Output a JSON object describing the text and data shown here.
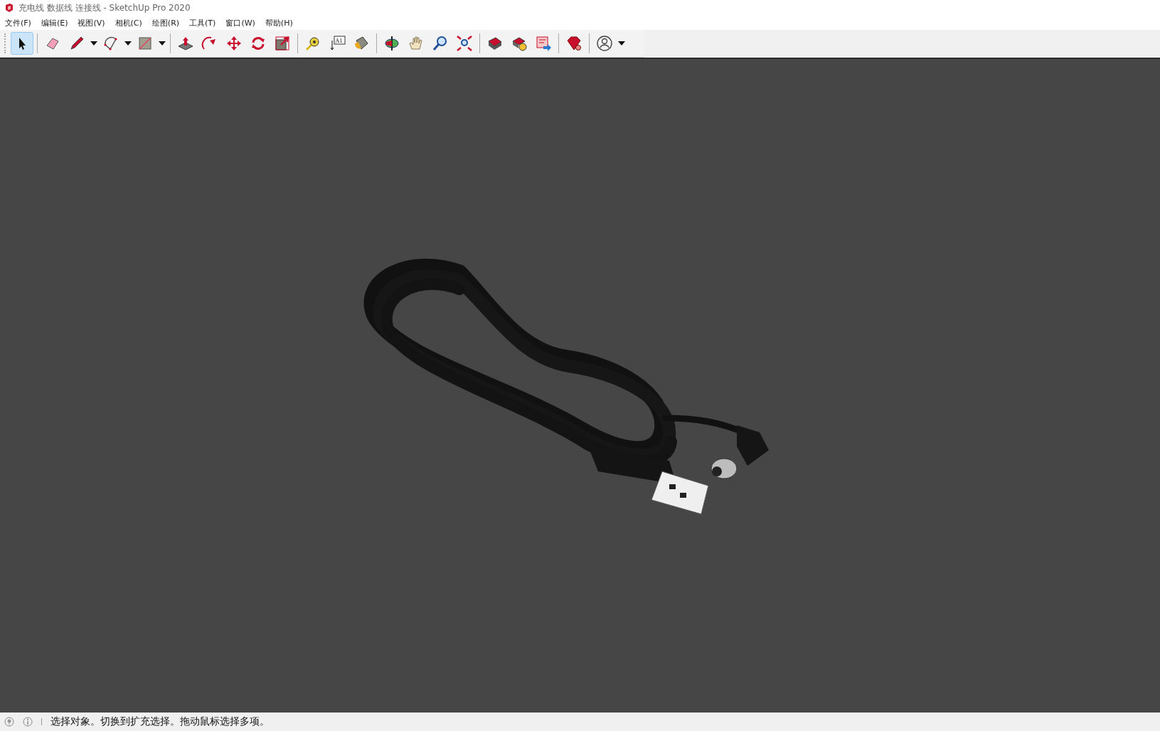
{
  "window": {
    "title": "充电线 数据线 连接线 - SketchUp Pro 2020"
  },
  "menu": [
    "文件(F)",
    "编辑(E)",
    "视图(V)",
    "相机(C)",
    "绘图(R)",
    "工具(T)",
    "窗口(W)",
    "帮助(H)"
  ],
  "toolbar": {
    "groups": [
      [
        {
          "kind": "select",
          "selected": true,
          "dropdown": false
        }
      ],
      [
        {
          "kind": "eraser",
          "selected": false,
          "dropdown": false
        },
        {
          "kind": "pencil",
          "selected": false,
          "dropdown": true
        },
        {
          "kind": "arc",
          "selected": false,
          "dropdown": true
        },
        {
          "kind": "rectangle",
          "selected": false,
          "dropdown": true
        }
      ],
      [
        {
          "kind": "pushpull",
          "selected": false,
          "dropdown": false
        },
        {
          "kind": "followme",
          "selected": false,
          "dropdown": false
        },
        {
          "kind": "move",
          "selected": false,
          "dropdown": false
        },
        {
          "kind": "rotate",
          "selected": false,
          "dropdown": false
        },
        {
          "kind": "scale",
          "selected": false,
          "dropdown": false
        }
      ],
      [
        {
          "kind": "tape",
          "selected": false,
          "dropdown": false
        },
        {
          "kind": "text",
          "selected": false,
          "dropdown": false,
          "label": "A1"
        },
        {
          "kind": "paint",
          "selected": false,
          "dropdown": false
        }
      ],
      [
        {
          "kind": "orbit",
          "selected": false,
          "dropdown": false
        },
        {
          "kind": "pan",
          "selected": false,
          "dropdown": false
        },
        {
          "kind": "zoom",
          "selected": false,
          "dropdown": false
        },
        {
          "kind": "extents",
          "selected": false,
          "dropdown": false
        }
      ],
      [
        {
          "kind": "warehouse",
          "selected": false,
          "dropdown": false
        },
        {
          "kind": "extensions",
          "selected": false,
          "dropdown": false
        },
        {
          "kind": "send",
          "selected": false,
          "dropdown": false
        }
      ],
      [
        {
          "kind": "ruby",
          "selected": false,
          "dropdown": false
        }
      ],
      [
        {
          "kind": "account",
          "selected": false,
          "dropdown": true
        }
      ]
    ]
  },
  "status_bar": {
    "text": "选择对象。切换到扩充选择。拖动鼠标选择多项。"
  }
}
